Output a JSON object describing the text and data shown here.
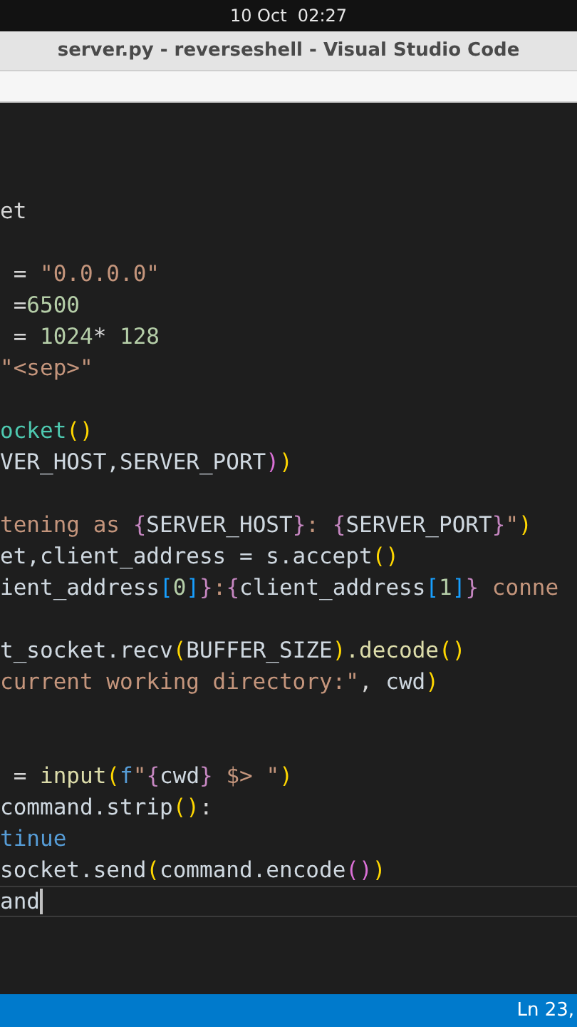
{
  "top_bar": {
    "date_time": "10 Oct  02:27"
  },
  "window": {
    "title": "server.py - reverseshell - Visual Studio Code"
  },
  "editor": {
    "lines": [
      {
        "current": false,
        "segments": [
          {
            "kind": "plain",
            "text": "et"
          }
        ]
      },
      {
        "current": false
      },
      {
        "current": false,
        "segments": [
          {
            "kind": "plain",
            "text": " = "
          },
          {
            "kind": "string",
            "text": "\"0.0.0.0\""
          }
        ]
      },
      {
        "current": false,
        "segments": [
          {
            "kind": "plain",
            "text": " ="
          },
          {
            "kind": "number",
            "text": "6500"
          }
        ]
      },
      {
        "current": false,
        "segments": [
          {
            "kind": "plain",
            "text": " = "
          },
          {
            "kind": "number",
            "text": "1024"
          },
          {
            "kind": "plain",
            "text": "* "
          },
          {
            "kind": "number",
            "text": "128"
          }
        ]
      },
      {
        "current": false,
        "segments": [
          {
            "kind": "string",
            "text": "\"<sep>\""
          }
        ]
      },
      {
        "current": false
      },
      {
        "current": false,
        "segments": [
          {
            "kind": "class",
            "text": "ocket"
          },
          {
            "kind": "bracket",
            "text": "()"
          }
        ]
      },
      {
        "current": false,
        "segments": [
          {
            "kind": "variable",
            "text": "VER_HOST,SERVER_PORT"
          },
          {
            "kind": "bracket2",
            "text": ")"
          },
          {
            "kind": "bracket",
            "text": ")"
          }
        ]
      },
      {
        "current": false
      },
      {
        "current": false,
        "segments": [
          {
            "kind": "string",
            "text": "tening as "
          },
          {
            "kind": "bracket3",
            "text": "{"
          },
          {
            "kind": "variable",
            "text": "SERVER_HOST"
          },
          {
            "kind": "bracket3",
            "text": "}"
          },
          {
            "kind": "string",
            "text": ": "
          },
          {
            "kind": "bracket3",
            "text": "{"
          },
          {
            "kind": "variable",
            "text": "SERVER_PORT"
          },
          {
            "kind": "bracket3",
            "text": "}"
          },
          {
            "kind": "string",
            "text": "\""
          },
          {
            "kind": "bracket",
            "text": ")"
          }
        ]
      },
      {
        "current": false,
        "segments": [
          {
            "kind": "variable",
            "text": "et,client_address = s.accept"
          },
          {
            "kind": "bracket",
            "text": "()"
          }
        ]
      },
      {
        "current": false,
        "segments": [
          {
            "kind": "variable",
            "text": "ient_address"
          },
          {
            "kind": "bracket4",
            "text": "["
          },
          {
            "kind": "number",
            "text": "0"
          },
          {
            "kind": "bracket4",
            "text": "]"
          },
          {
            "kind": "bracket3",
            "text": "}"
          },
          {
            "kind": "string",
            "text": ":"
          },
          {
            "kind": "bracket3",
            "text": "{"
          },
          {
            "kind": "variable",
            "text": "client_address"
          },
          {
            "kind": "bracket4",
            "text": "["
          },
          {
            "kind": "number",
            "text": "1"
          },
          {
            "kind": "bracket4",
            "text": "]"
          },
          {
            "kind": "bracket3",
            "text": "}"
          },
          {
            "kind": "string",
            "text": " conne"
          }
        ]
      },
      {
        "current": false
      },
      {
        "current": false,
        "segments": [
          {
            "kind": "variable",
            "text": "t_socket.recv"
          },
          {
            "kind": "bracket",
            "text": "("
          },
          {
            "kind": "variable",
            "text": "BUFFER_SIZE"
          },
          {
            "kind": "bracket",
            "text": ")"
          },
          {
            "kind": "function",
            "text": ".decode"
          },
          {
            "kind": "bracket",
            "text": "()"
          }
        ]
      },
      {
        "current": false,
        "segments": [
          {
            "kind": "string",
            "text": "current working directory:\""
          },
          {
            "kind": "plain",
            "text": ", "
          },
          {
            "kind": "variable",
            "text": "cwd"
          },
          {
            "kind": "bracket",
            "text": ")"
          }
        ]
      },
      {
        "current": false
      },
      {
        "current": false
      },
      {
        "current": false,
        "segments": [
          {
            "kind": "plain",
            "text": " = "
          },
          {
            "kind": "function",
            "text": "input"
          },
          {
            "kind": "bracket",
            "text": "("
          },
          {
            "kind": "keyword",
            "text": "f"
          },
          {
            "kind": "string",
            "text": "\""
          },
          {
            "kind": "bracket3",
            "text": "{"
          },
          {
            "kind": "variable",
            "text": "cwd"
          },
          {
            "kind": "bracket3",
            "text": "}"
          },
          {
            "kind": "string",
            "text": " $> \""
          },
          {
            "kind": "bracket",
            "text": ")"
          }
        ]
      },
      {
        "current": false,
        "segments": [
          {
            "kind": "variable",
            "text": "command.strip"
          },
          {
            "kind": "bracket",
            "text": "()"
          },
          {
            "kind": "plain",
            "text": ":"
          }
        ]
      },
      {
        "current": false,
        "segments": [
          {
            "kind": "keyword",
            "text": "tinue"
          }
        ]
      },
      {
        "current": false,
        "segments": [
          {
            "kind": "variable",
            "text": "socket.send"
          },
          {
            "kind": "bracket",
            "text": "("
          },
          {
            "kind": "variable",
            "text": "command.encode"
          },
          {
            "kind": "bracket2",
            "text": "()"
          },
          {
            "kind": "bracket",
            "text": ")"
          }
        ]
      },
      {
        "current": true,
        "segments": [
          {
            "kind": "variable",
            "text": "and"
          }
        ]
      }
    ]
  },
  "status_bar": {
    "position": "Ln 23,"
  }
}
